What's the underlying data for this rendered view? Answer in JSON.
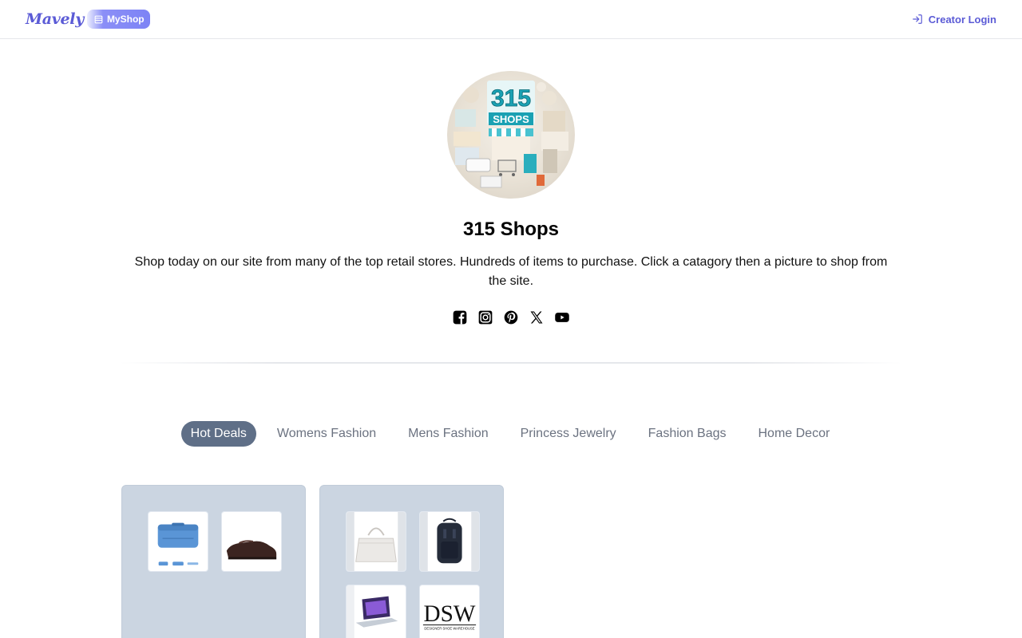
{
  "header": {
    "brand": "Mavely",
    "myshop_label": "MyShop",
    "login_label": "Creator Login"
  },
  "profile": {
    "avatar_text_top": "315",
    "avatar_text_bottom": "SHOPS",
    "title": "315 Shops",
    "description": "Shop today on our site from many of the top retail stores. Hundreds of items to purchase. Click a catagory then a picture to shop from the site.",
    "socials": [
      "facebook-icon",
      "instagram-icon",
      "pinterest-icon",
      "x-icon",
      "youtube-icon"
    ]
  },
  "tabs": [
    {
      "label": "Hot Deals",
      "active": true
    },
    {
      "label": "Womens Fashion",
      "active": false
    },
    {
      "label": "Mens Fashion",
      "active": false
    },
    {
      "label": "Princess Jewelry",
      "active": false
    },
    {
      "label": "Fashion Bags",
      "active": false
    },
    {
      "label": "Home Decor",
      "active": false
    }
  ],
  "cards": [
    {
      "items": [
        "blue-storage-case",
        "brown-loafer-shoe"
      ]
    },
    {
      "items": [
        "white-handbag",
        "black-backpack",
        "laptop",
        "dsw-logo"
      ]
    }
  ],
  "dsw": {
    "logo_text": "DSW",
    "tagline": "DESIGNER SHOE WAREHOUSE"
  },
  "colors": {
    "brand": "#5b5bd6",
    "active_tab": "#5f6f87",
    "card_bg": "#cbd5e1"
  }
}
